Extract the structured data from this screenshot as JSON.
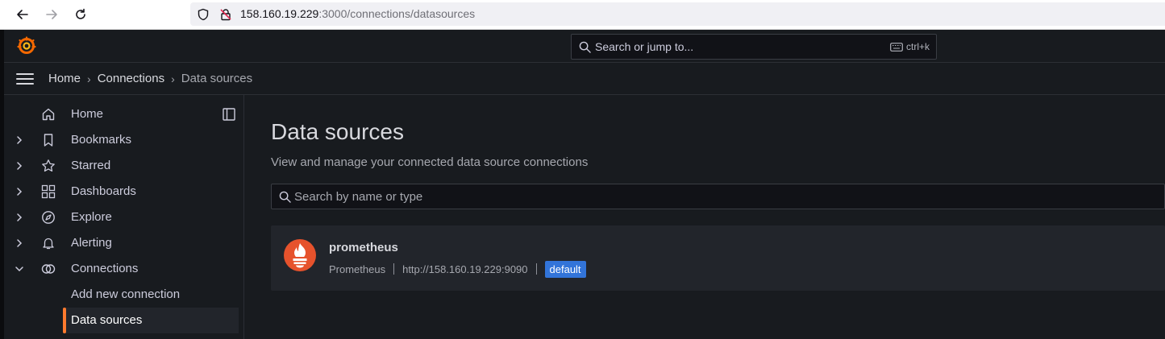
{
  "browser": {
    "url_host": "158.160.19.229",
    "url_path": ":3000/connections/datasources"
  },
  "topbar": {
    "search_placeholder": "Search or jump to...",
    "shortcut": "ctrl+k"
  },
  "breadcrumb": {
    "items": [
      "Home",
      "Connections",
      "Data sources"
    ]
  },
  "sidebar": {
    "items": [
      {
        "label": "Home",
        "icon": "home-icon"
      },
      {
        "label": "Bookmarks",
        "icon": "bookmark-icon"
      },
      {
        "label": "Starred",
        "icon": "star-icon"
      },
      {
        "label": "Dashboards",
        "icon": "dashboards-icon"
      },
      {
        "label": "Explore",
        "icon": "compass-icon"
      },
      {
        "label": "Alerting",
        "icon": "bell-icon"
      },
      {
        "label": "Connections",
        "icon": "connections-icon"
      }
    ],
    "sub_items": [
      "Add new connection",
      "Data sources"
    ]
  },
  "main": {
    "title": "Data sources",
    "subtitle": "View and manage your connected data source connections",
    "filter_placeholder": "Search by name or type",
    "datasources": [
      {
        "name": "prometheus",
        "type": "Prometheus",
        "url": "http://158.160.19.229:9090",
        "badge": "default"
      }
    ]
  },
  "colors": {
    "accent": "#ff7a2e",
    "badge_bg": "#3274d9",
    "prometheus": "#e6522c"
  }
}
